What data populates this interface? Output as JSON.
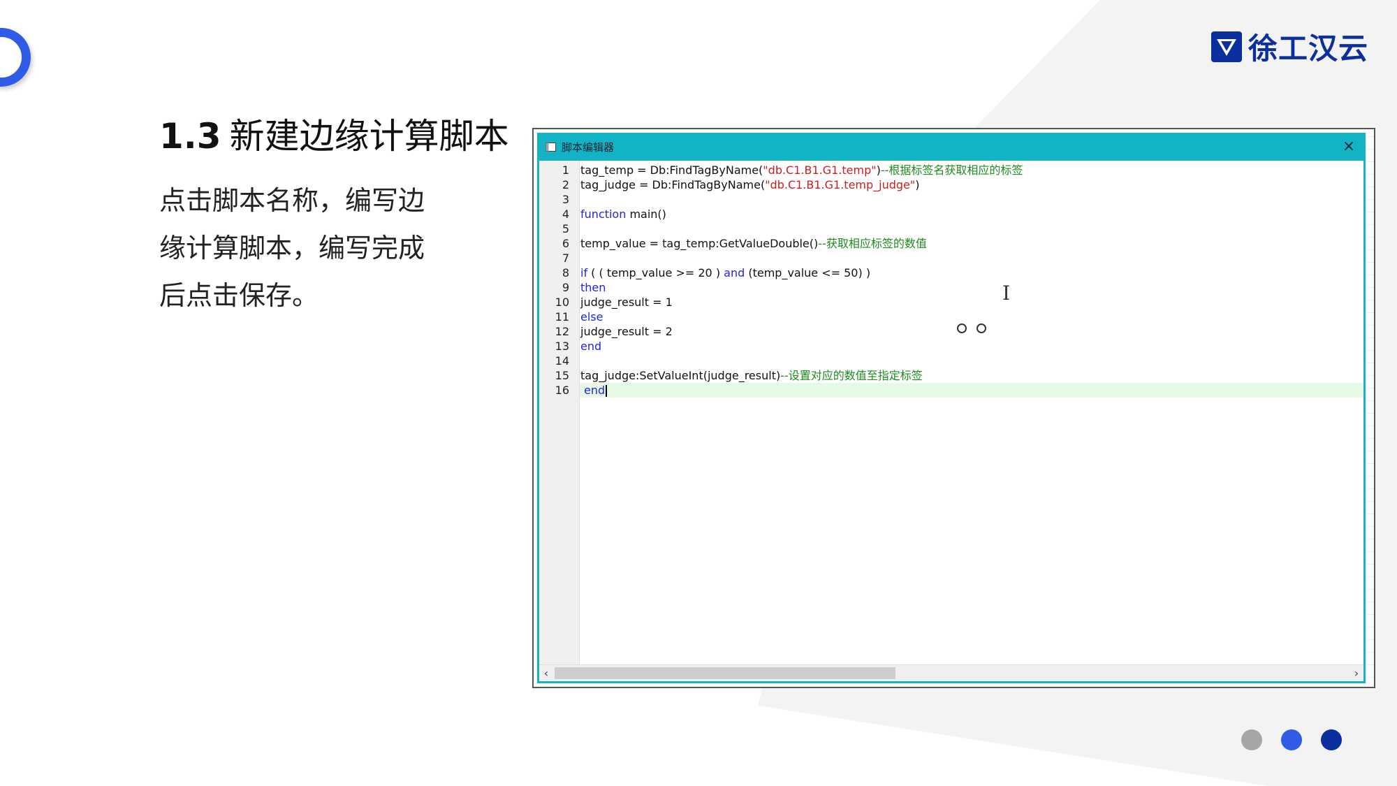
{
  "brand": {
    "name": "徐工汉云",
    "logo_icon": "xcmg-shield-icon",
    "color": "#0b2f9e"
  },
  "slide": {
    "title_number": "1.3",
    "title_text": "新建边缘计算脚本",
    "description": [
      "点击脚本名称，编写边",
      "缘计算脚本，编写完成",
      "后点击保存。"
    ]
  },
  "editor": {
    "window_title": "脚本编辑器",
    "close_label": "×",
    "accent_color": "#11b3c4",
    "line_numbers": [
      "1",
      "2",
      "3",
      "4",
      "5",
      "6",
      "7",
      "8",
      "9",
      "10",
      "11",
      "12",
      "13",
      "14",
      "15",
      "16"
    ],
    "lines": [
      [
        {
          "t": "tag_temp = Db:FindTagByName(",
          "c": "p"
        },
        {
          "t": "\"db.C1.B1.G1.temp\"",
          "c": "s"
        },
        {
          "t": ")",
          "c": "p"
        },
        {
          "t": "--根据标签名获取相应的标签",
          "c": "c"
        }
      ],
      [
        {
          "t": "tag_judge = Db:FindTagByName(",
          "c": "p"
        },
        {
          "t": "\"db.C1.B1.G1.temp_judge\"",
          "c": "s"
        },
        {
          "t": ")",
          "c": "p"
        }
      ],
      [],
      [
        {
          "t": "function",
          "c": "k"
        },
        {
          "t": " main()",
          "c": "p"
        }
      ],
      [],
      [
        {
          "t": "    temp_value = tag_temp:GetValueDouble()",
          "c": "p"
        },
        {
          "t": "--获取相应标签的数值",
          "c": "c"
        }
      ],
      [],
      [
        {
          "t": "    ",
          "c": "p"
        },
        {
          "t": "if",
          "c": "k"
        },
        {
          "t": " ( ( temp_value >= 20 )  ",
          "c": "p"
        },
        {
          "t": "and",
          "c": "k"
        },
        {
          "t": "  (temp_value <= 50) )",
          "c": "p"
        }
      ],
      [
        {
          "t": "    ",
          "c": "p"
        },
        {
          "t": "then",
          "c": "k"
        }
      ],
      [
        {
          "t": "      judge_result = 1",
          "c": "p"
        }
      ],
      [
        {
          "t": "    ",
          "c": "p"
        },
        {
          "t": "else",
          "c": "k"
        }
      ],
      [
        {
          "t": "      judge_result = 2",
          "c": "p"
        }
      ],
      [
        {
          "t": "    ",
          "c": "p"
        },
        {
          "t": "end",
          "c": "k"
        }
      ],
      [],
      [
        {
          "t": "    tag_judge:SetValueInt(judge_result)",
          "c": "p"
        },
        {
          "t": "--设置对应的数值至指定标签",
          "c": "c"
        }
      ],
      [
        {
          "t": "end",
          "c": "k"
        }
      ]
    ],
    "current_line": 16,
    "scroll_left_label": "‹",
    "scroll_right_label": "›",
    "scroll_position": 0.43
  },
  "pagination": {
    "colors": [
      "#a6a6a6",
      "#2f5be6",
      "#0b2f9e"
    ]
  }
}
